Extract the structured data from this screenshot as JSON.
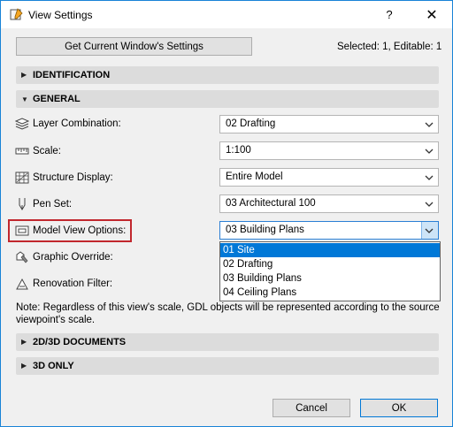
{
  "window": {
    "title": "View Settings",
    "help_label": "?",
    "close_label": "✕"
  },
  "toolbar": {
    "get_settings_label": "Get Current Window's Settings",
    "selected_info": "Selected: 1, Editable: 1"
  },
  "sections": {
    "identification": "IDENTIFICATION",
    "general": "GENERAL",
    "docs": "2D/3D DOCUMENTS",
    "only3d": "3D ONLY"
  },
  "general": {
    "layer_label": "Layer Combination:",
    "layer_value": "02 Drafting",
    "scale_label": "Scale:",
    "scale_value": "1:100",
    "structure_label": "Structure Display:",
    "structure_value": "Entire Model",
    "pen_label": "Pen Set:",
    "pen_value": "03 Architectural 100",
    "mvo_label": "Model View Options:",
    "mvo_value": "03 Building Plans",
    "graphic_label": "Graphic Override:",
    "renovation_label": "Renovation Filter:"
  },
  "mvo_options": [
    "01 Site",
    "02 Drafting",
    "03 Building Plans",
    "04 Ceiling Plans"
  ],
  "note": "Note: Regardless of this view's scale, GDL objects will be represented according to the source viewpoint's scale.",
  "buttons": {
    "cancel": "Cancel",
    "ok": "OK"
  },
  "colors": {
    "accent": "#0078d7",
    "highlight": "#c1272d"
  }
}
